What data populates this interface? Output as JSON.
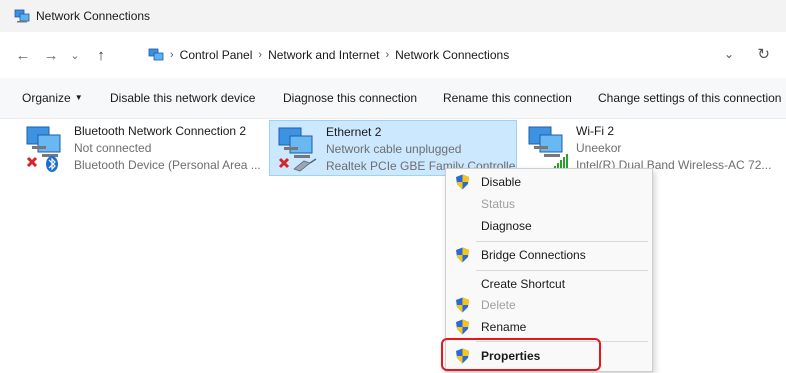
{
  "window": {
    "title": "Network Connections"
  },
  "address": {
    "crumbs": [
      "Control Panel",
      "Network and Internet",
      "Network Connections"
    ],
    "sep": "›"
  },
  "nav": {
    "back": "←",
    "forward": "→",
    "recent": "⌄",
    "up": "↑",
    "dropdown": "⌄",
    "refresh": "↻"
  },
  "toolbar": {
    "organize": "Organize",
    "disable_device": "Disable this network device",
    "diagnose": "Diagnose this connection",
    "rename": "Rename this connection",
    "change_settings": "Change settings of this connection"
  },
  "connections": [
    {
      "name": "Bluetooth Network Connection 2",
      "status": "Not connected",
      "device": "Bluetooth Device (Personal Area ...",
      "icon": "bluetooth-network-icon"
    },
    {
      "name": "Ethernet 2",
      "status": "Network cable unplugged",
      "device": "Realtek PCIe GBE Family Controller",
      "icon": "ethernet-network-icon"
    },
    {
      "name": "Wi-Fi 2",
      "status": "Uneekor",
      "device": "Intel(R) Dual Band Wireless-AC 72...",
      "icon": "wifi-network-icon"
    }
  ],
  "context_menu": {
    "disable": "Disable",
    "status": "Status",
    "diagnose": "Diagnose",
    "bridge": "Bridge Connections",
    "shortcut": "Create Shortcut",
    "delete": "Delete",
    "rename": "Rename",
    "properties": "Properties"
  },
  "colors": {
    "selection_bg": "#cce8ff",
    "selection_border": "#99d1ff",
    "highlight": "#e8151b",
    "shield_blue": "#2a6ad8",
    "shield_yellow": "#f5c518"
  }
}
